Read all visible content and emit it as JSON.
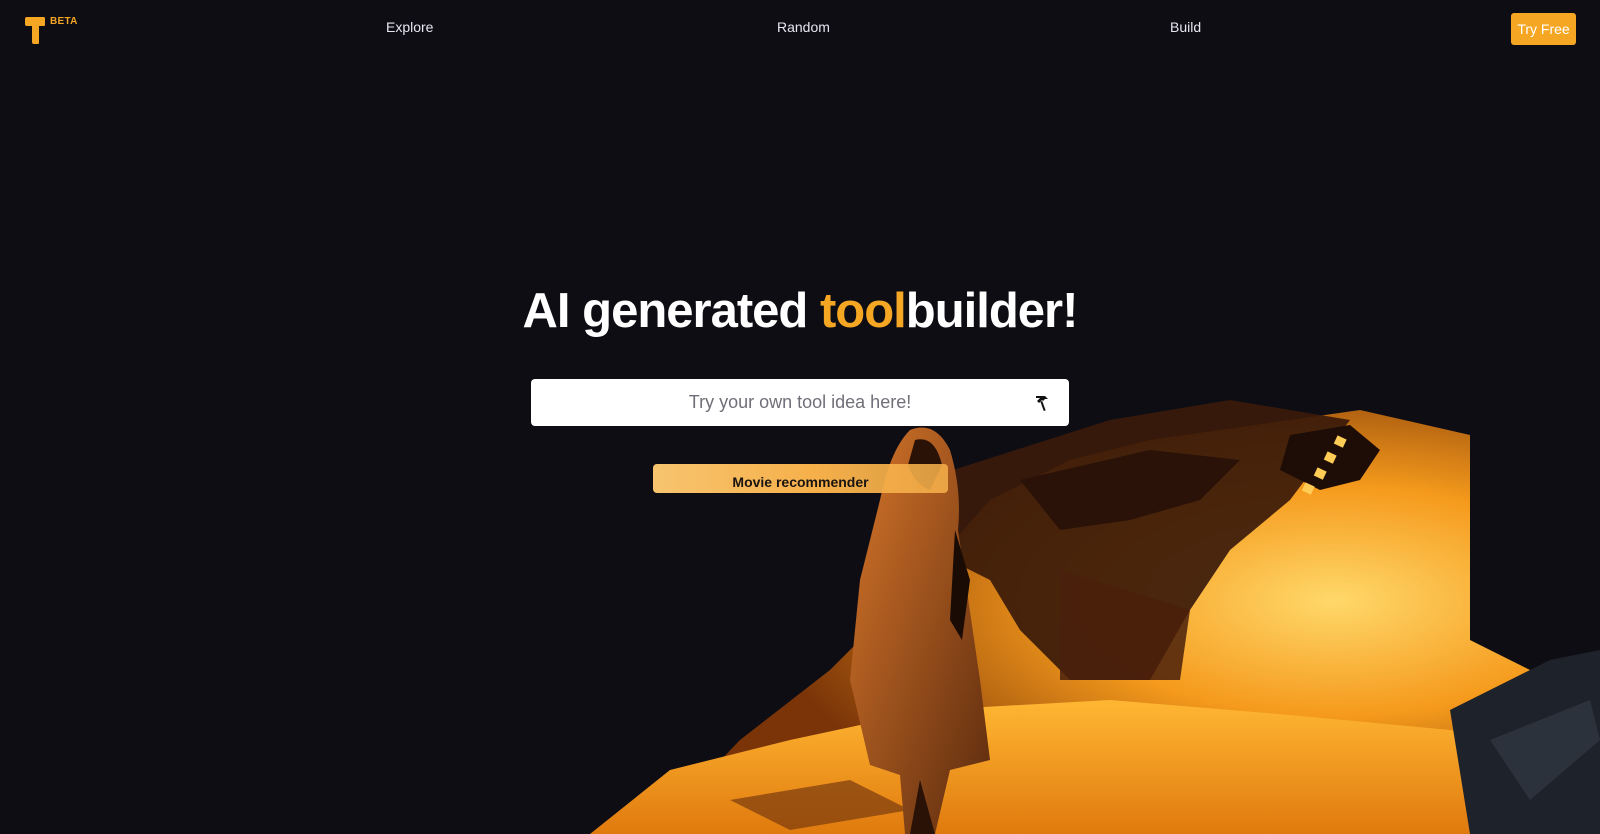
{
  "header": {
    "logo_badge": "BETA",
    "nav": [
      {
        "label": "Explore"
      },
      {
        "label": "Random"
      },
      {
        "label": "Build"
      }
    ],
    "cta_label": "Try Free"
  },
  "hero": {
    "headline_part1": "AI generated ",
    "headline_accent": "tool",
    "headline_part2": "builder!",
    "search_placeholder": "Try your own tool idea here!",
    "submit_icon": "hammer-icon",
    "suggestion_label": "Movie recommender"
  },
  "colors": {
    "accent": "#f5a623",
    "background": "#0f0d14",
    "search_bg": "#ffffff"
  }
}
